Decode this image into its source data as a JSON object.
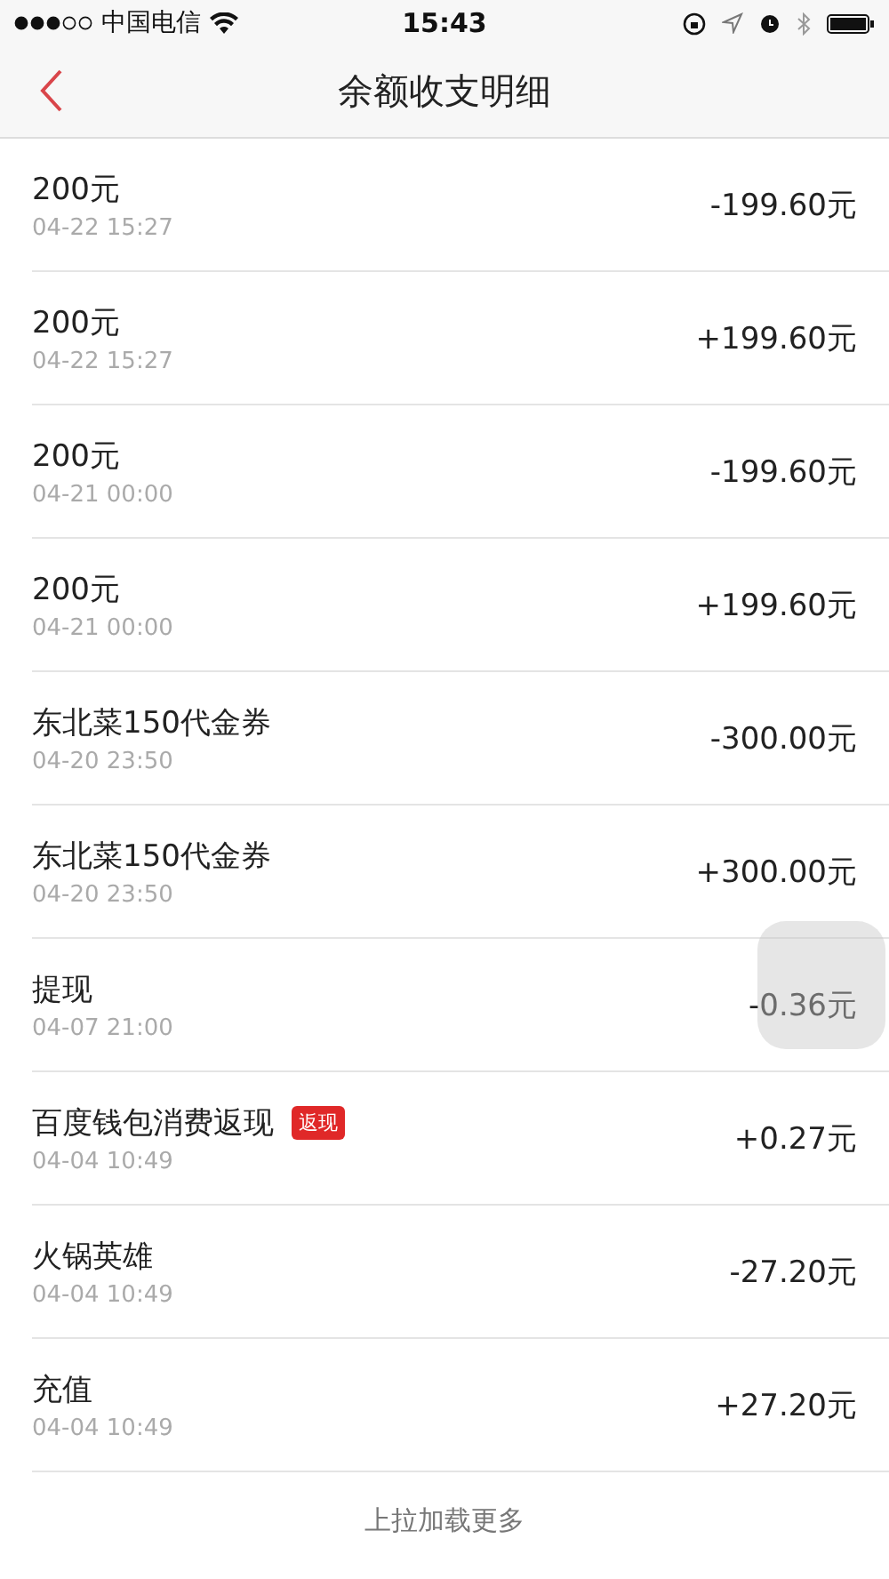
{
  "status_bar": {
    "carrier": "中国电信",
    "time": "15:43"
  },
  "header": {
    "title": "余额收支明细"
  },
  "rows": [
    {
      "title": "200元",
      "time": "04-22 15:27",
      "amount": "-199.60元"
    },
    {
      "title": "200元",
      "time": "04-22 15:27",
      "amount": "+199.60元"
    },
    {
      "title": "200元",
      "time": "04-21 00:00",
      "amount": "-199.60元"
    },
    {
      "title": "200元",
      "time": "04-21 00:00",
      "amount": "+199.60元"
    },
    {
      "title": "东北菜150代金券",
      "time": "04-20 23:50",
      "amount": "-300.00元"
    },
    {
      "title": "东北菜150代金券",
      "time": "04-20 23:50",
      "amount": "+300.00元"
    },
    {
      "title": "提现",
      "time": "04-07 21:00",
      "amount": "-0.36元"
    },
    {
      "title": "百度钱包消费返现",
      "badge": "返现",
      "time": "04-04 10:49",
      "amount": "+0.27元"
    },
    {
      "title": "火锅英雄",
      "time": "04-04 10:49",
      "amount": "-27.20元"
    },
    {
      "title": "充值",
      "time": "04-04 10:49",
      "amount": "+27.20元"
    }
  ],
  "footer": {
    "text": "上拉加载更多"
  }
}
